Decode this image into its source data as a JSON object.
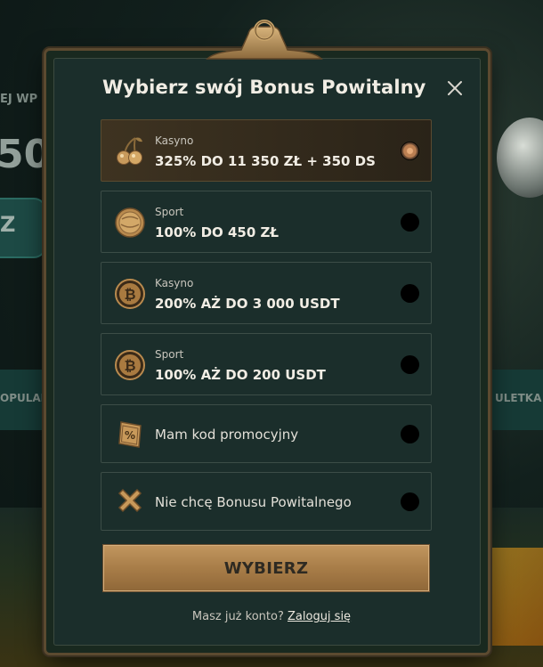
{
  "background": {
    "left_partial_text_1": "EJ WP",
    "left_partial_number": "50",
    "left_partial_button": "Z",
    "left_partial_nav": "OPULAR",
    "right_partial_nav": "ULETKA"
  },
  "modal": {
    "title": "Wybierz swój Bonus Powitalny",
    "options": [
      {
        "category": "Kasyno",
        "label": "325% DO 11 350 ZŁ + 350 DS",
        "icon": "cherries-icon",
        "selected": true
      },
      {
        "category": "Sport",
        "label": "100% DO 450 ZŁ",
        "icon": "coin-ball-icon",
        "selected": false
      },
      {
        "category": "Kasyno",
        "label": "200% AŻ DO 3 000 USDT",
        "icon": "bitcoin-coin-icon",
        "selected": false
      },
      {
        "category": "Sport",
        "label": "100% AŻ DO 200 USDT",
        "icon": "bitcoin-coin-icon",
        "selected": false
      },
      {
        "label": "Mam kod promocyjny",
        "icon": "promo-ticket-icon",
        "selected": false
      },
      {
        "label": "Nie chcę Bonusu Powitalnego",
        "icon": "cross-icon",
        "selected": false
      }
    ],
    "submit_label": "WYBIERZ",
    "login_prompt": "Masz już konto?",
    "login_link": "Zaloguj się"
  },
  "colors": {
    "accent_gold": "#b08850",
    "panel": "#1b2e2b",
    "selected_row": "#3e3321"
  }
}
